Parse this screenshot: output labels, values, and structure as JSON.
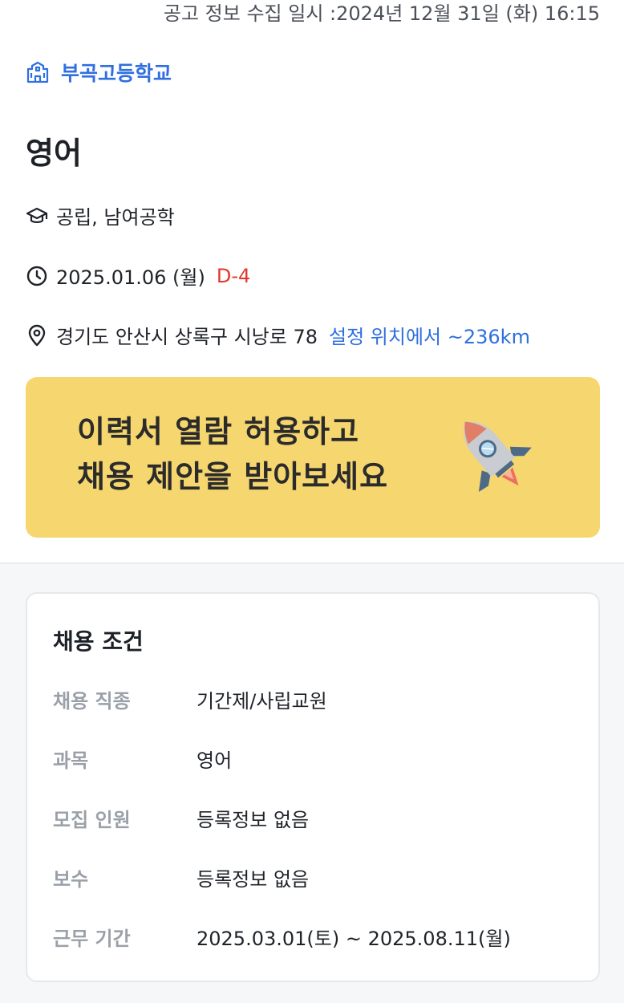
{
  "header": {
    "timestamp": "공고 정보 수집 일시 :2024년 12월 31일 (화) 16:15"
  },
  "school": {
    "icon": "school-building-icon",
    "name": "부곡고등학교"
  },
  "subject": "영어",
  "details": {
    "type": {
      "icon": "graduation-cap-icon",
      "text": "공립, 남여공학"
    },
    "deadline": {
      "icon": "clock-icon",
      "date": "2025.01.06 (월)",
      "dday": "D-4"
    },
    "location": {
      "icon": "map-pin-icon",
      "address": "경기도 안산시 상록구 시낭로 78",
      "distance": "설정 위치에서 ~236km"
    }
  },
  "banner": {
    "line1": "이력서 열람 허용하고",
    "line2": "채용 제안을 받아보세요",
    "icon": "rocket-icon",
    "bg_color": "#f6d66e"
  },
  "conditions": {
    "title": "채용 조건",
    "rows": [
      {
        "label": "채용 직종",
        "value": "기간제/사립교원"
      },
      {
        "label": "과목",
        "value": "영어"
      },
      {
        "label": "모집 인원",
        "value": "등록정보 없음"
      },
      {
        "label": "보수",
        "value": "등록정보 없음"
      },
      {
        "label": "근무 기간",
        "value": "2025.03.01(토) ~ 2025.08.11(월)"
      }
    ]
  },
  "colors": {
    "accent": "#2f6fe0",
    "dday": "#e0382f",
    "label_gray": "#9aa0a8"
  }
}
